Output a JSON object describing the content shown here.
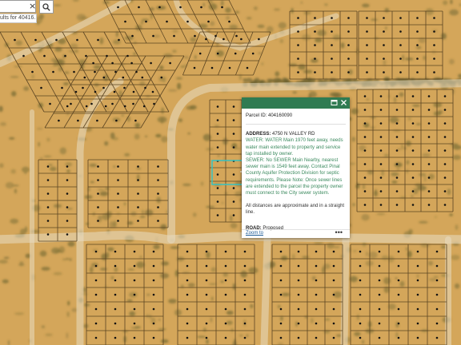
{
  "search": {
    "clear_glyph": "×",
    "hint_text": "ults for 40416...",
    "button_icon": "search-icon"
  },
  "popup": {
    "title": "Parcel ID: 404160090",
    "header_icons": [
      "dock-icon",
      "close-icon"
    ],
    "address_label": "ADDRESS:",
    "address_value": "4750 N VALLEY RD",
    "water_text": "WATER: WATER Main 1970 feet away, needs water main extended to property and service tap installed by owner.",
    "sewer_text": "SEWER: No SEWER Main Nearby, nearest sewer main is 1549 feet away. Contact Pinal County Aquifer Protection Division for septic requirements. Please Note: Once sewer lines are extended to the parcel the property owner must connect to the City sewer system.",
    "note_text": "All distances are approximate and in a straight line.",
    "road_label": "ROAD:",
    "road_value": "Proposed",
    "zoom_link": "Zoom to",
    "more_glyph": "•••"
  },
  "colors": {
    "terrain": "#d4a65a",
    "vegetation": "#8a7a3a",
    "parcel_line": "#5a4422",
    "road": "#e7dcc2",
    "highlight": "#34c2c2",
    "popup_header": "#2f7b52",
    "popup_text_green": "#3b8a5e",
    "link": "#1b5a96",
    "dot": "#111111"
  }
}
